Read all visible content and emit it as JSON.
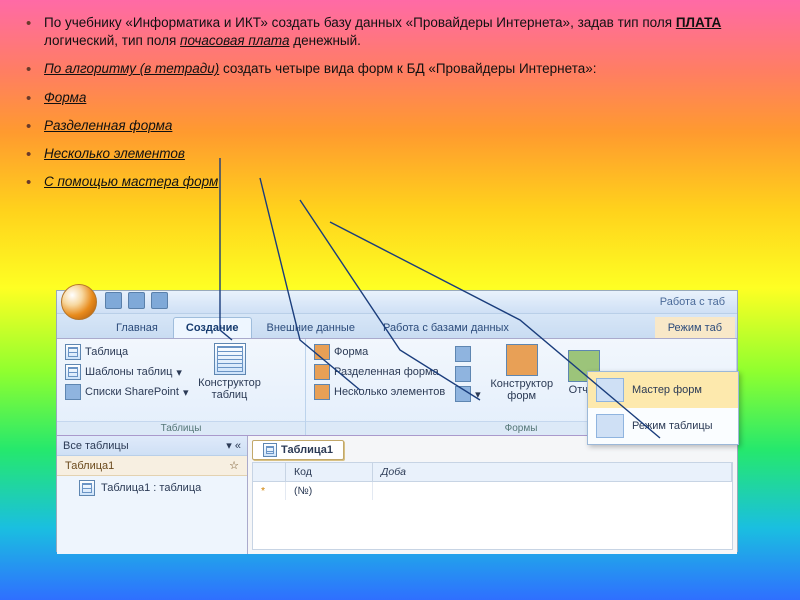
{
  "bullets": {
    "b1_pre": "По учебнику «Информатика и ИКТ» создать базу данных «Провайдеры Интернета», задав тип поля ",
    "b1_bold": "ПЛАТА",
    "b1_mid": " логический, тип поля ",
    "b1_ital": "почасовая плата",
    "b1_post": " денежный.",
    "b2_pre": "",
    "b2_u": "По алгоритму (в тетради)",
    "b2_post": " создать четыре вида форм к БД «Провайдеры Интернета»:",
    "b3": "Форма",
    "b4": "Разделенная форма",
    "b5": "Несколько элементов",
    "b6": "С помощью мастера форм"
  },
  "access": {
    "title_right": "Работа с таб",
    "tabs": {
      "home": "Главная",
      "create": "Создание",
      "external": "Внешние данные",
      "dbtools": "Работа с базами данных",
      "mode": "Режим таб"
    },
    "grp_tables": {
      "table": "Таблица",
      "templates": "Шаблоны таблиц",
      "sharepoint": "Списки SharePoint",
      "designer": "Конструктор таблиц",
      "label": "Таблицы"
    },
    "grp_forms": {
      "form": "Форма",
      "split": "Разделенная форма",
      "multi": "Несколько элементов",
      "designer": "Конструктор форм",
      "report": "Отчет",
      "label": "Формы"
    },
    "navpane": {
      "all": "Все таблицы",
      "group": "Таблица1",
      "item": "Таблица1 : таблица"
    },
    "doc": {
      "tab": "Таблица1",
      "col_id": "Код",
      "col_add": "Доба",
      "row_new": "*",
      "row_no": "(№)"
    },
    "dropdown": {
      "wizard": "Мастер форм",
      "datasheet": "Режим таблицы"
    }
  }
}
